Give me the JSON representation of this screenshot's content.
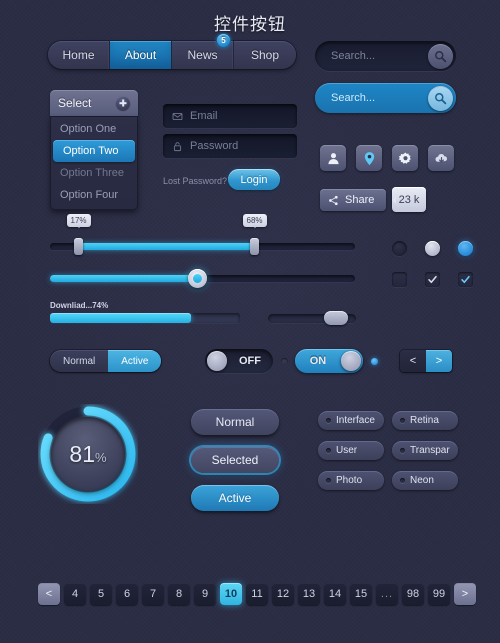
{
  "title": "控件按钮",
  "nav": {
    "tabs": [
      {
        "label": "Home",
        "active": false
      },
      {
        "label": "About",
        "active": true
      },
      {
        "label": "News",
        "active": false,
        "badge": "5"
      },
      {
        "label": "Shop",
        "active": false
      }
    ]
  },
  "search": {
    "dark_placeholder": "Search...",
    "blue_placeholder": "Search...",
    "icon": "search-icon"
  },
  "select": {
    "label": "Select",
    "add_icon": "plus-icon",
    "options": [
      {
        "label": "Option One",
        "state": "normal"
      },
      {
        "label": "Option Two",
        "state": "selected"
      },
      {
        "label": "Option Three",
        "state": "dim"
      },
      {
        "label": "Option Four",
        "state": "normal"
      }
    ]
  },
  "login": {
    "email_placeholder": "Email",
    "email_icon": "envelope-icon",
    "password_placeholder": "Password",
    "password_icon": "lock-icon",
    "lost_password": "Lost Password?",
    "submit_label": "Login"
  },
  "icon_buttons": [
    {
      "name": "user-icon"
    },
    {
      "name": "location-pin-icon"
    },
    {
      "name": "gear-icon"
    },
    {
      "name": "cloud-download-icon"
    }
  ],
  "share": {
    "label": "Share",
    "icon": "share-icon",
    "count": "23 k"
  },
  "sliders": {
    "range_low_label": "17%",
    "range_high_label": "68%",
    "single_value": "48%"
  },
  "download": {
    "label": "Downliad...74%",
    "percent": 74
  },
  "radios": [
    {
      "state": "empty"
    },
    {
      "state": "gray"
    },
    {
      "state": "blue"
    }
  ],
  "checkboxes": [
    {
      "state": "empty"
    },
    {
      "state": "gray-check"
    },
    {
      "state": "blue-check"
    }
  ],
  "segment": {
    "options": [
      {
        "label": "Normal",
        "active": false
      },
      {
        "label": "Active",
        "active": true
      }
    ]
  },
  "toggles": {
    "off_label": "OFF",
    "on_label": "ON"
  },
  "arrows": {
    "prev": "<",
    "next": ">"
  },
  "ring": {
    "value": "81",
    "percent_symbol": "%",
    "progress": 81
  },
  "buttons": [
    {
      "label": "Normal"
    },
    {
      "label": "Selected"
    },
    {
      "label": "Active"
    }
  ],
  "tags": [
    {
      "label": "Interface"
    },
    {
      "label": "Retina"
    },
    {
      "label": "User"
    },
    {
      "label": "Transpar"
    },
    {
      "label": "Photo"
    },
    {
      "label": "Neon"
    }
  ],
  "pagination": {
    "prev": "<",
    "next": ">",
    "pages": [
      "4",
      "5",
      "6",
      "7",
      "8",
      "9",
      "10",
      "11",
      "12",
      "13",
      "14",
      "15",
      "...",
      "98",
      "99"
    ],
    "current": "10",
    "ellipsis": "..."
  }
}
